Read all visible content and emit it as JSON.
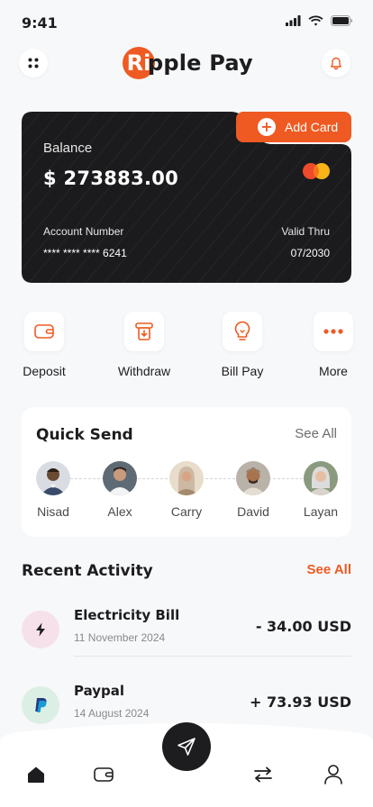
{
  "status_bar": {
    "time": "9:41"
  },
  "header": {
    "logo_initials": "Ri",
    "logo_text": "pple Pay"
  },
  "card": {
    "add_card_label": "Add Card",
    "balance_label": "Balance",
    "balance_value": "$ 273883.00",
    "account_label": "Account Number",
    "account_value": "**** **** **** 6241",
    "valid_label": "Valid Thru",
    "valid_value": "07/2030"
  },
  "actions": [
    {
      "label": "Deposit",
      "icon": "wallet-icon"
    },
    {
      "label": "Withdraw",
      "icon": "withdraw-icon"
    },
    {
      "label": "Bill Pay",
      "icon": "bulb-icon"
    },
    {
      "label": "More",
      "icon": "more-icon"
    }
  ],
  "quick_send": {
    "title": "Quick Send",
    "see_all": "See All",
    "contacts": [
      {
        "name": "Nisad"
      },
      {
        "name": "Alex"
      },
      {
        "name": "Carry"
      },
      {
        "name": "David"
      },
      {
        "name": "Layan"
      }
    ]
  },
  "recent": {
    "title": "Recent Activity",
    "see_all": "See All",
    "items": [
      {
        "name": "Electricity Bill",
        "date": "11 November 2024",
        "amount": "- 34.00 USD",
        "icon": "bolt-icon"
      },
      {
        "name": "Paypal",
        "date": "14 August 2024",
        "amount": "+ 73.93 USD",
        "icon": "paypal-icon"
      }
    ]
  },
  "colors": {
    "accent": "#ef5a22",
    "card": "#1c1c1e",
    "bg": "#f7f8fa"
  }
}
